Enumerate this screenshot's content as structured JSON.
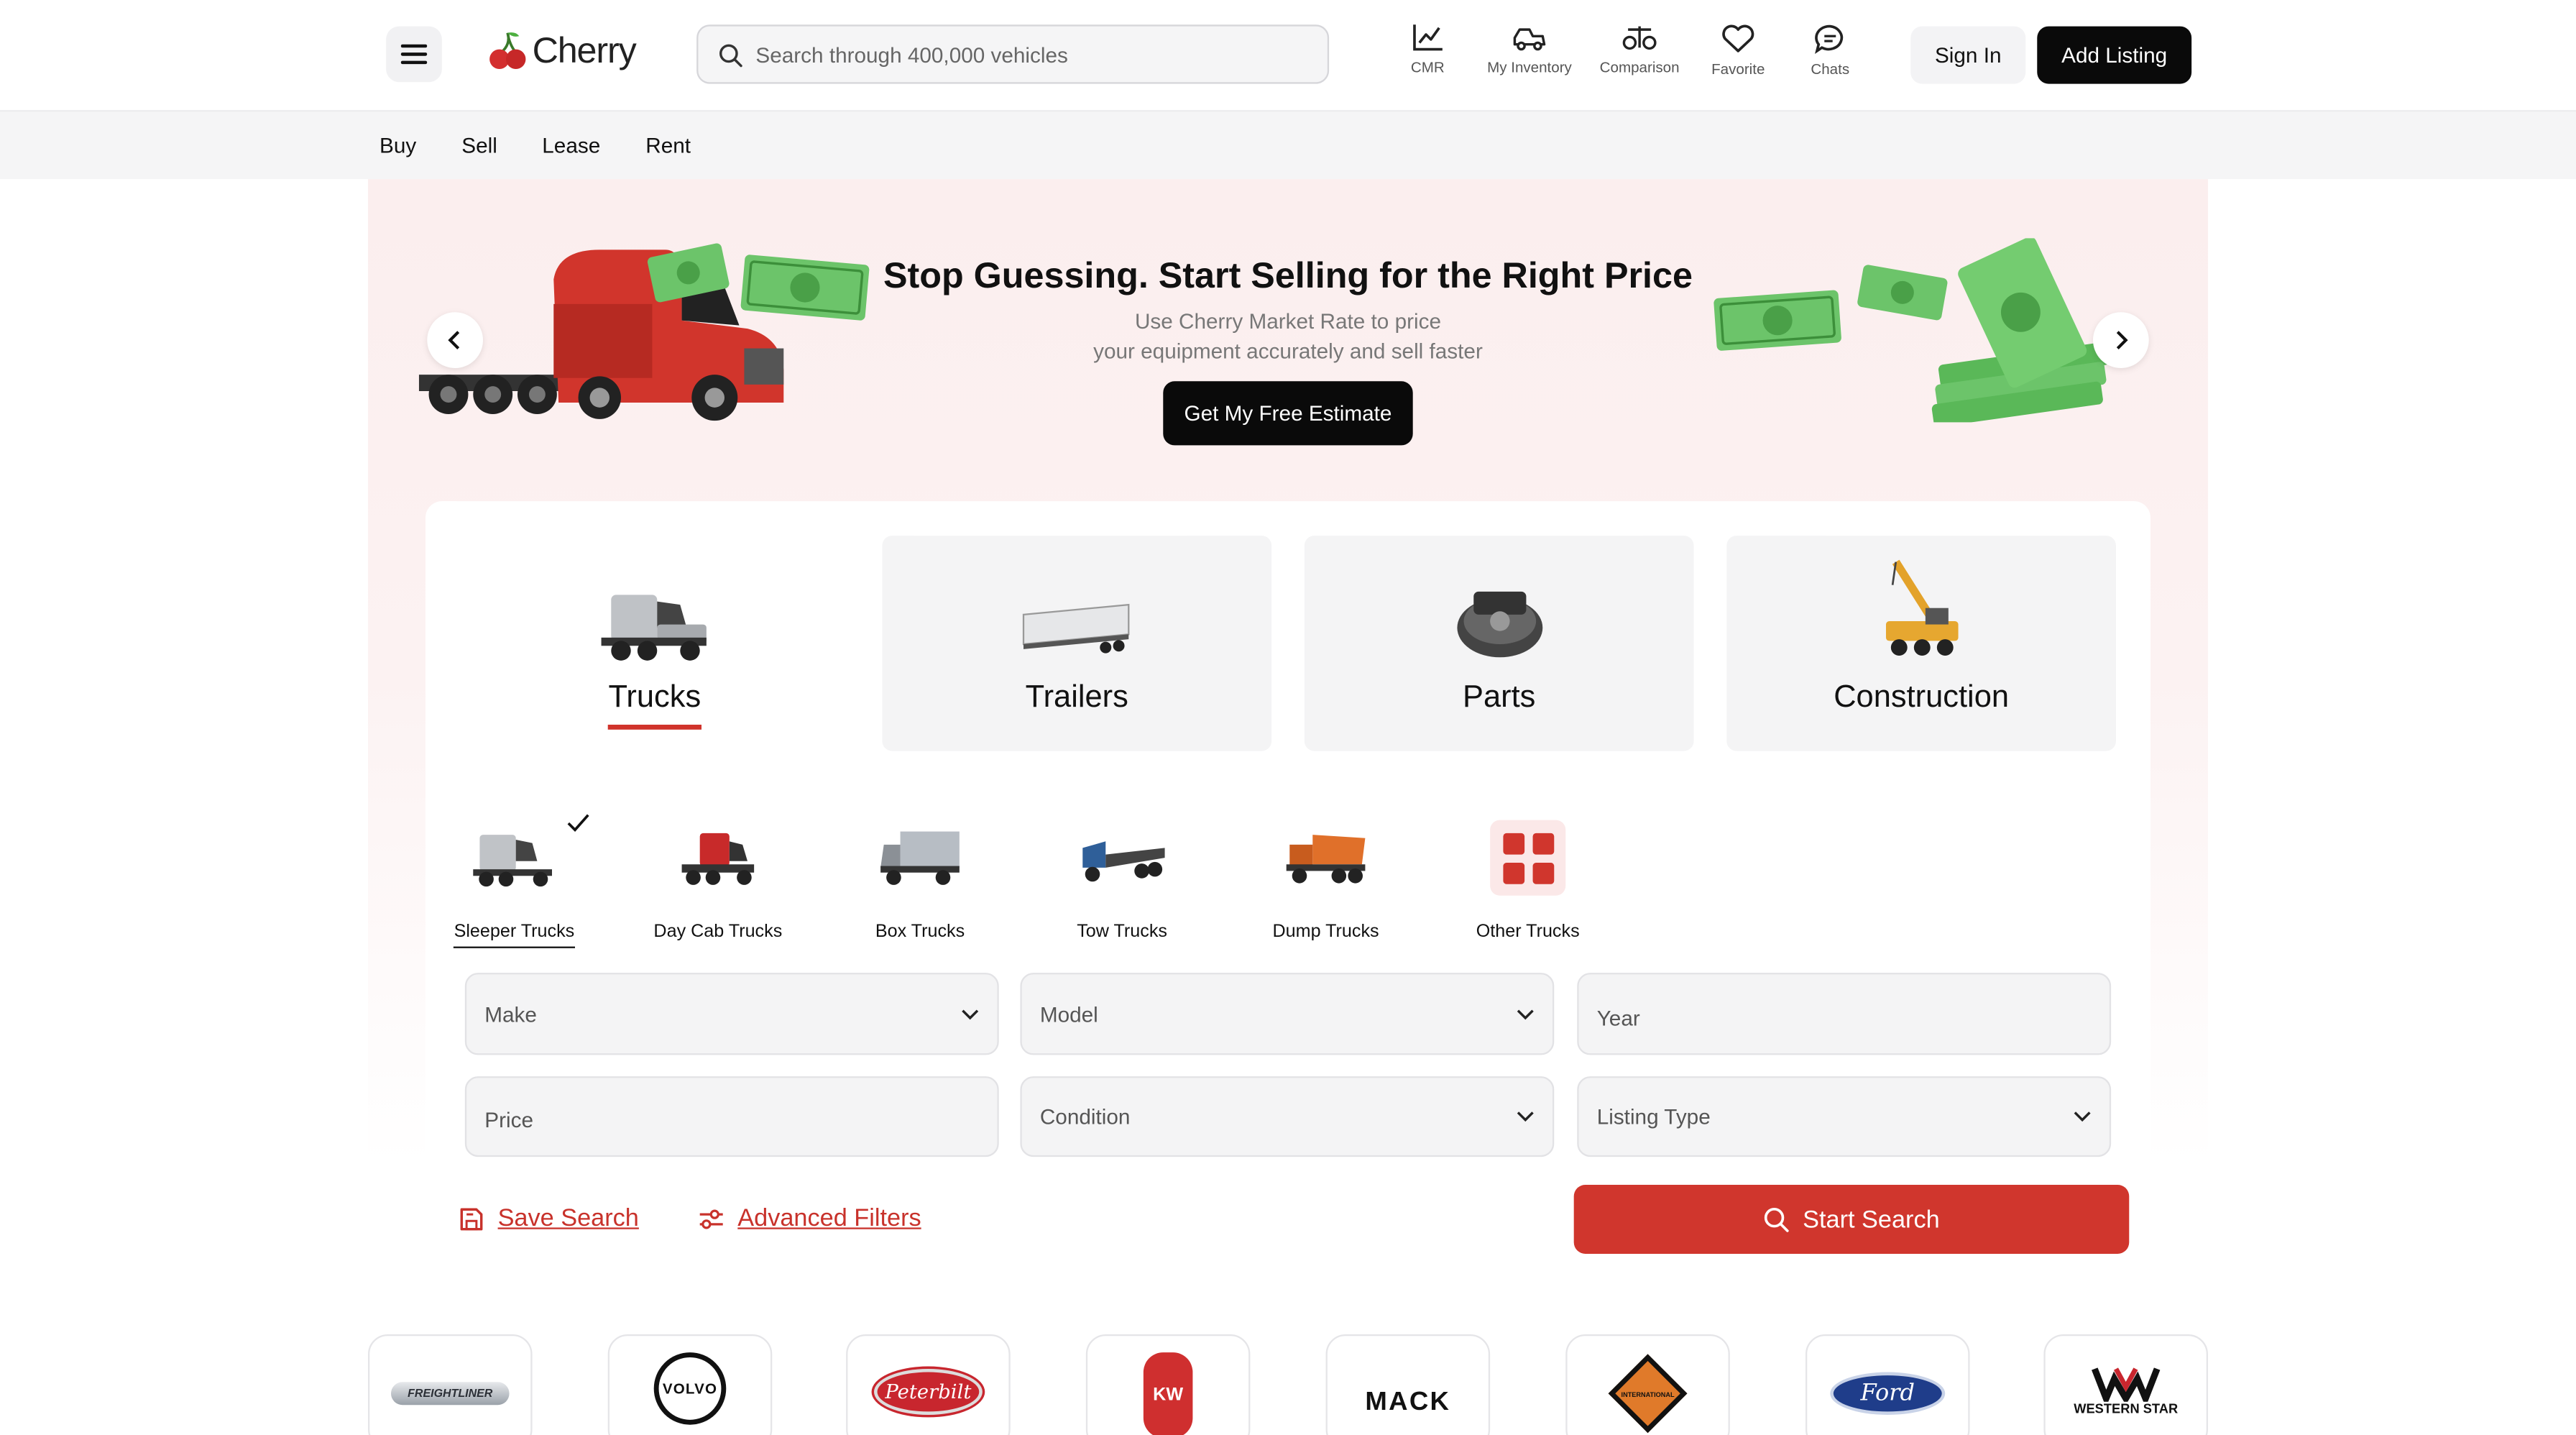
{
  "header": {
    "logo_text": "Cherry",
    "search_placeholder": "Search through 400,000 vehicles",
    "nav": [
      {
        "label": "CMR",
        "icon": "chart-icon"
      },
      {
        "label": "My Inventory",
        "icon": "truck-icon"
      },
      {
        "label": "Comparison",
        "icon": "scale-icon"
      },
      {
        "label": "Favorite",
        "icon": "heart-icon"
      },
      {
        "label": "Chats",
        "icon": "chat-icon"
      }
    ],
    "sign_in": "Sign In",
    "add_listing": "Add Listing"
  },
  "subnav": [
    "Buy",
    "Sell",
    "Lease",
    "Rent"
  ],
  "hero": {
    "title": "Stop Guessing. Start Selling for the Right Price",
    "sub_line1": "Use Cherry Market Rate to price",
    "sub_line2": "your equipment accurately and sell faster",
    "cta": "Get My Free Estimate"
  },
  "categories": [
    {
      "label": "Trucks",
      "active": true
    },
    {
      "label": "Trailers",
      "active": false
    },
    {
      "label": "Parts",
      "active": false
    },
    {
      "label": "Construction",
      "active": false
    }
  ],
  "subcategories": [
    {
      "label": "Sleeper Trucks",
      "active": true
    },
    {
      "label": "Day Cab Trucks",
      "active": false
    },
    {
      "label": "Box Trucks",
      "active": false
    },
    {
      "label": "Tow Trucks",
      "active": false
    },
    {
      "label": "Dump Trucks",
      "active": false
    },
    {
      "label": "Other Trucks",
      "active": false
    }
  ],
  "filters": {
    "make": "Make",
    "model": "Model",
    "year": "Year",
    "price": "Price",
    "condition": "Condition",
    "listing_type": "Listing Type"
  },
  "actions": {
    "save_search": "Save Search",
    "advanced_filters": "Advanced Filters",
    "start_search": "Start Search"
  },
  "brands": [
    "FREIGHTLINER",
    "VOLVO",
    "Peterbilt",
    "KW",
    "MACK",
    "INTERNATIONAL",
    "Ford",
    "WESTERN STAR"
  ],
  "colors": {
    "accent": "#d0362d",
    "dark": "#0a0a0a",
    "money": "#5cbf5a"
  }
}
